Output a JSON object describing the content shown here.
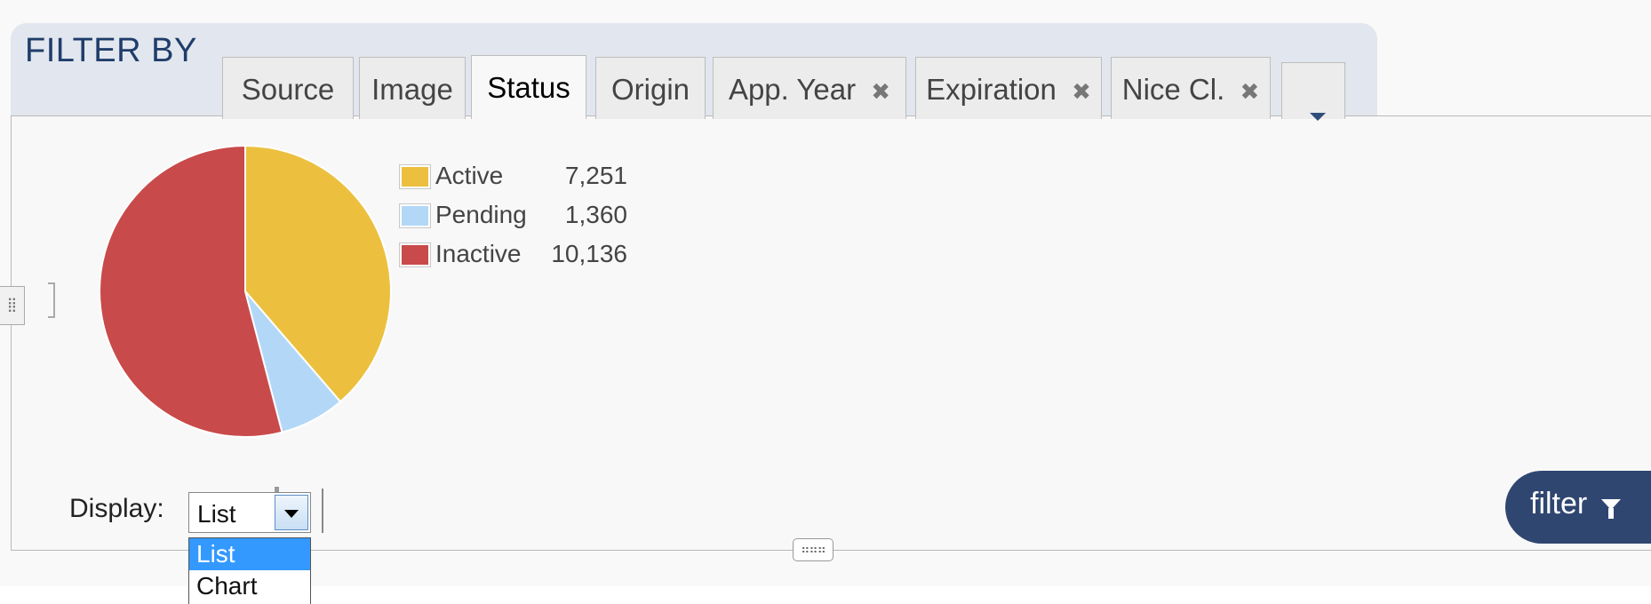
{
  "header": {
    "title": "FILTER BY"
  },
  "tabs": [
    {
      "label": "Source",
      "closable": false,
      "active": false
    },
    {
      "label": "Image",
      "closable": false,
      "active": false
    },
    {
      "label": "Status",
      "closable": false,
      "active": true
    },
    {
      "label": "Origin",
      "closable": false,
      "active": false
    },
    {
      "label": "App. Year",
      "closable": true,
      "active": false
    },
    {
      "label": "Expiration",
      "closable": true,
      "active": false
    },
    {
      "label": "Nice Cl.",
      "closable": true,
      "active": false
    }
  ],
  "tab_close_glyph": "✖",
  "more_tabs_icon": "chevron-down-icon",
  "status_chart": {
    "chart_data": {
      "type": "pie",
      "categories": [
        "Active",
        "Pending",
        "Inactive"
      ],
      "values": [
        7251,
        1360,
        10136
      ],
      "value_labels": [
        "7,251",
        "1,360",
        "10,136"
      ],
      "colors": [
        "#ecc03e",
        "#b3d8f7",
        "#c94a4a"
      ]
    }
  },
  "display": {
    "label": "Display:",
    "selected": "List",
    "options": [
      "List",
      "Chart"
    ],
    "highlighted": "List"
  },
  "filter_button": {
    "label": "filter",
    "icon": "funnel-icon"
  },
  "side_handle_glyph": "⣿",
  "bottom_handle_glyph": "⠶⠶⠶"
}
